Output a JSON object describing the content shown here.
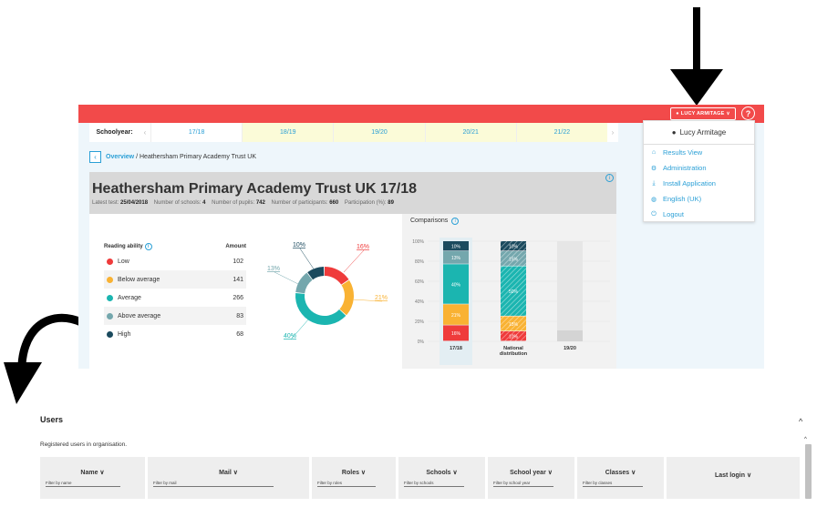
{
  "colors": {
    "brand_red": "#f24a4a",
    "link_blue": "#2a9fd6",
    "low": "#ef3b3b",
    "below_average": "#f9b233",
    "average": "#1bb5b0",
    "above_average": "#74a7ad",
    "high": "#1b4a5e"
  },
  "topbar": {
    "user_button_label": "LUCY ARMITAGE",
    "user_icon": "user-circle-icon",
    "caret_icon": "chevron-down-icon",
    "help_icon": "?"
  },
  "schoolyear": {
    "label": "Schoolyear:",
    "prev": "‹",
    "next": "›",
    "years": [
      "17/18",
      "18/19",
      "19/20",
      "20/21",
      "21/22"
    ]
  },
  "breadcrumb": {
    "back": "‹",
    "overview": "Overview",
    "separator": "/",
    "current": "Heathersham Primary Academy Trust UK"
  },
  "school": {
    "title": "Heathersham Primary Academy Trust UK 17/18",
    "latest_test_label": "Latest test:",
    "latest_test": "25/04/2018",
    "schools_label": "Number of schools:",
    "schools": "4",
    "pupils_label": "Number of pupils:",
    "pupils": "742",
    "participants_label": "Number of participants:",
    "participants": "660",
    "participation_label": "Participation (%):",
    "participation": "89"
  },
  "reading_table": {
    "header_label": "Reading ability",
    "header_amount": "Amount",
    "rows": [
      {
        "label": "Low",
        "amount": "102"
      },
      {
        "label": "Below average",
        "amount": "141"
      },
      {
        "label": "Average",
        "amount": "266"
      },
      {
        "label": "Above average",
        "amount": "83"
      },
      {
        "label": "High",
        "amount": "68"
      }
    ]
  },
  "chart_data": [
    {
      "type": "pie",
      "title": "",
      "categories": [
        "Low",
        "Below average",
        "Average",
        "Above average",
        "High"
      ],
      "values": [
        16,
        21,
        40,
        13,
        10
      ],
      "labels": [
        "16%",
        "21%",
        "40%",
        "13%",
        "10%"
      ]
    },
    {
      "type": "bar",
      "title": "Comparisons",
      "categories": [
        "17/18",
        "National distribution",
        "19/20"
      ],
      "stacked": true,
      "ylim": [
        0,
        100
      ],
      "yticks": [
        "0%",
        "20%",
        "40%",
        "60%",
        "80%",
        "100%"
      ],
      "series": [
        {
          "name": "Low",
          "values": [
            16,
            10,
            0
          ],
          "labels": [
            "16%",
            "10%",
            ""
          ]
        },
        {
          "name": "Below average",
          "values": [
            21,
            15,
            0
          ],
          "labels": [
            "21%",
            "15%",
            ""
          ]
        },
        {
          "name": "Average",
          "values": [
            40,
            50,
            0
          ],
          "labels": [
            "40%",
            "50%",
            ""
          ]
        },
        {
          "name": "Above average",
          "values": [
            13,
            15,
            0
          ],
          "labels": [
            "13%",
            "15%",
            ""
          ]
        },
        {
          "name": "High",
          "values": [
            10,
            10,
            0
          ],
          "labels": [
            "10%",
            "10%",
            ""
          ]
        }
      ]
    }
  ],
  "comparisons": {
    "title": "Comparisons"
  },
  "dropdown": {
    "user_name": "Lucy Armitage",
    "items": [
      {
        "label": "Results View",
        "icon": "home-icon"
      },
      {
        "label": "Administration",
        "icon": "settings-icon"
      },
      {
        "label": "Install Application",
        "icon": "download-icon"
      },
      {
        "label": "English (UK)",
        "icon": "globe-icon"
      },
      {
        "label": "Logout",
        "icon": "power-icon"
      }
    ]
  },
  "users": {
    "title": "Users",
    "subtitle": "Registered users in organisation.",
    "columns": [
      {
        "title": "Name ∨",
        "filter": "Filter by name"
      },
      {
        "title": "Mail ∨",
        "filter": "Filter by mail"
      },
      {
        "title": "Roles ∨",
        "filter": "Filter by roles"
      },
      {
        "title": "Schools ∨",
        "filter": "Filter by schools"
      },
      {
        "title": "School year ∨",
        "filter": "Filter by school year"
      },
      {
        "title": "Classes ∨",
        "filter": "Filter by classes"
      },
      {
        "title": "Last login ∨",
        "filter": ""
      }
    ]
  }
}
